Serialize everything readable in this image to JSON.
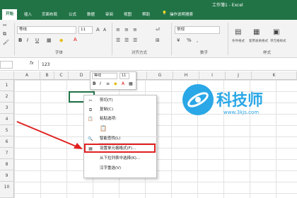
{
  "title": "工作簿1 - Excel",
  "tabs": [
    "开始",
    "插入",
    "页面布局",
    "公式",
    "数据",
    "审阅",
    "视图",
    "帮助",
    "操作说明搜索"
  ],
  "ribbon": {
    "font_name": "等线",
    "font_size": "11",
    "groups": [
      "字体",
      "对齐方式",
      "数字",
      "样式"
    ],
    "right_labels": [
      "条件格式",
      "套用表格格式",
      "单元格样式"
    ],
    "number_format": "常规"
  },
  "formula": {
    "fx": "fx",
    "value": "123"
  },
  "columns": [
    "A",
    "B",
    "C",
    "D",
    "E",
    "F",
    "G",
    "H",
    "I",
    "J",
    "K"
  ],
  "rows": [
    "1",
    "2",
    "3",
    "4",
    "5",
    "6",
    "7",
    "8",
    "9",
    "10"
  ],
  "cell_value": "123",
  "mini_toolbar": {
    "font_name": "等线",
    "font_size": "11",
    "bold": "B",
    "italic": "I"
  },
  "context_menu": [
    {
      "label": "剪切(T)",
      "icon": "scissors-icon",
      "glyph": "✂"
    },
    {
      "label": "复制(C)",
      "icon": "copy-icon",
      "glyph": "⧉"
    },
    {
      "label": "粘贴选项:",
      "icon": "paste-icon",
      "glyph": "📋"
    },
    {
      "label": "",
      "icon": "paste-option-icon",
      "glyph": "📋"
    },
    {
      "label": "智能查找(L)",
      "icon": "search-icon",
      "glyph": "🔍"
    },
    {
      "label": "设置单元格格式(F)...",
      "icon": "format-cells-icon",
      "glyph": "▦"
    },
    {
      "label": "从下拉列表中选择(K)...",
      "icon": "",
      "glyph": ""
    },
    {
      "label": "汉字重选(V)",
      "icon": "",
      "glyph": ""
    }
  ],
  "watermark": {
    "name": "科技师",
    "url": "www.3kjs.com"
  },
  "colors": {
    "accent": "#217346",
    "highlight": "#e02020",
    "watermark": "#2aa7e6"
  }
}
